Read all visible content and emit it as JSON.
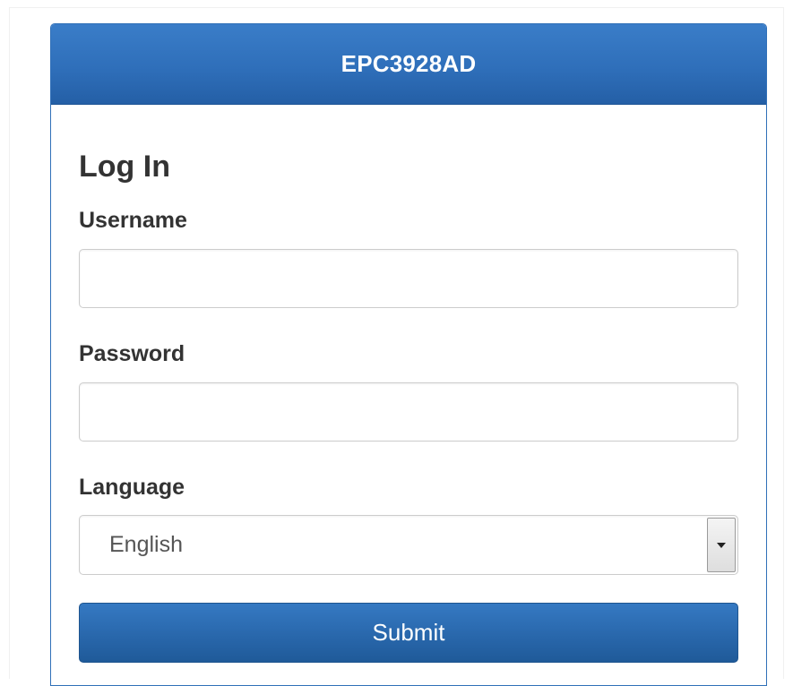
{
  "header": {
    "title": "EPC3928AD"
  },
  "form": {
    "title": "Log In",
    "username": {
      "label": "Username",
      "value": "",
      "placeholder": ""
    },
    "password": {
      "label": "Password",
      "value": "",
      "placeholder": ""
    },
    "language": {
      "label": "Language",
      "selected": "English"
    },
    "submit_label": "Submit"
  },
  "colors": {
    "header_blue": "#2f6fba",
    "button_blue": "#2a69ae",
    "text_dark": "#333333"
  },
  "icons": {
    "language_dropdown": "triangle-down-icon"
  }
}
